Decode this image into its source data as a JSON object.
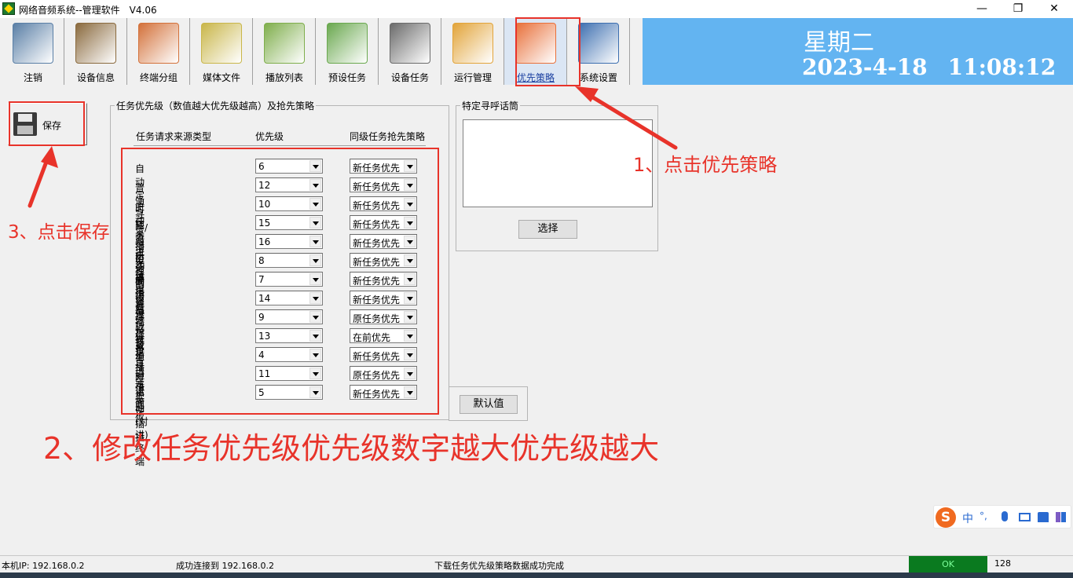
{
  "window": {
    "title": "网络音频系统--管理软件　V4.06",
    "minimize": "—",
    "maximize": "❐",
    "close": "✕"
  },
  "toolbar": {
    "items": [
      {
        "label": "注销",
        "icon": "computer-icon",
        "color": "#5a7fa6"
      },
      {
        "label": "设备信息",
        "icon": "speaker-icon",
        "color": "#8a6a3e"
      },
      {
        "label": "终端分组",
        "icon": "buildings-icon",
        "color": "#d3713a"
      },
      {
        "label": "媒体文件",
        "icon": "folders-icon",
        "color": "#c9b64a"
      },
      {
        "label": "播放列表",
        "icon": "list-icon",
        "color": "#7fae4c"
      },
      {
        "label": "预设任务",
        "icon": "clock-icon",
        "color": "#6aa84f"
      },
      {
        "label": "设备任务",
        "icon": "camera-icon",
        "color": "#6b6b6b"
      },
      {
        "label": "运行管理",
        "icon": "folder-people-icon",
        "color": "#e2a43a"
      },
      {
        "label": "优先策略",
        "icon": "paper-plane-icon",
        "color": "#e8703a"
      },
      {
        "label": "系统设置",
        "icon": "laptop-icon",
        "color": "#3d6fb0"
      }
    ],
    "active_index": 8
  },
  "datetime": {
    "weekday": "星期二",
    "date": "2023-4-18",
    "time": "11:08:12"
  },
  "save": {
    "label": "保存",
    "icon": "floppy-disk-icon"
  },
  "priority_group": {
    "legend": "任务优先级（数值越大优先级越高）及抢先策略",
    "headers": {
      "source": "任务请求来源类型",
      "priority": "优先级",
      "policy": "同级任务抢先策略"
    },
    "rows": [
      {
        "label": "自动定时任务",
        "priority": "6",
        "policy": "新任务优先"
      },
      {
        "label": "普通寻呼/对讲话筒",
        "priority": "12",
        "policy": "新任务优先"
      },
      {
        "label": "主动采播设备",
        "priority": "10",
        "policy": "新任务优先"
      },
      {
        "label": "紧急主动采播器",
        "priority": "15",
        "policy": "新任务优先"
      },
      {
        "label": "消防控制设备",
        "priority": "16",
        "policy": "新任务优先"
      },
      {
        "label": "无线电遥控设备",
        "priority": "8",
        "policy": "新任务优先"
      },
      {
        "label": "网络点播设备",
        "priority": "7",
        "policy": "新任务优先"
      },
      {
        "label": "管理软件插播",
        "priority": "14",
        "policy": "新任务优先"
      },
      {
        "label": "分控软件插播",
        "priority": "9",
        "policy": "原任务优先"
      },
      {
        "label": "特定寻呼话筒",
        "priority": "13",
        "policy": "在前优先"
      },
      {
        "label": "第三方软件插播",
        "priority": "4",
        "policy": "新任务优先"
      },
      {
        "label": "对讲面板",
        "priority": "11",
        "policy": "原任务优先"
      },
      {
        "label": "主动(对讲)终端",
        "priority": "5",
        "policy": "新任务优先"
      }
    ],
    "default_button": "默认值"
  },
  "mic_group": {
    "legend": "特定寻呼话筒",
    "select_button": "选择"
  },
  "annotations": {
    "step1": "1、点击优先策略",
    "step2": "2、修改任务优先级优先级数字越大优先级越大",
    "step3": "3、点击保存",
    "color": "#e8332a"
  },
  "ime": {
    "logo": "S",
    "lang": "中",
    "punct": "°,",
    "icons": [
      "mic-icon",
      "keyboard-icon",
      "shirt-icon",
      "apps-icon"
    ]
  },
  "status": {
    "local_ip": "本机IP: 192.168.0.2",
    "connection": "成功连接到 192.168.0.2",
    "message": "下载任务优先级策略数据成功完成",
    "ok": "OK",
    "count": "128"
  }
}
